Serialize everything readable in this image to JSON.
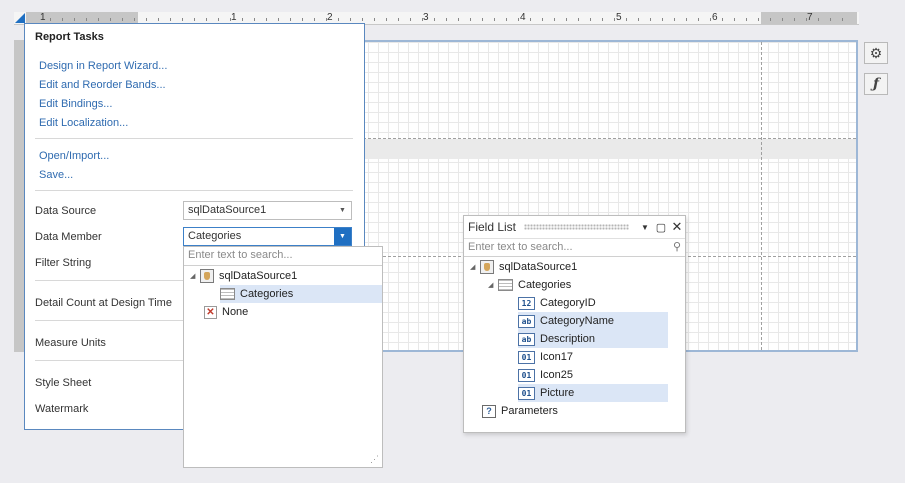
{
  "ruler": {
    "numbers": [
      "1",
      "1",
      "2",
      "3",
      "4",
      "5",
      "6",
      "7"
    ]
  },
  "side_buttons": {
    "settings": "⚙",
    "function": "ƒ"
  },
  "tasks": {
    "title": "Report Tasks",
    "links": [
      "Design in Report Wizard...",
      "Edit and Reorder Bands...",
      "Edit Bindings...",
      "Edit Localization..."
    ],
    "links2": [
      "Open/Import...",
      "Save..."
    ],
    "labels": {
      "data_source": "Data Source",
      "data_member": "Data Member",
      "filter_string": "Filter String",
      "detail_count": "Detail Count at Design Time",
      "measure_units": "Measure Units",
      "style_sheet": "Style Sheet",
      "watermark": "Watermark"
    },
    "data_source_value": "sqlDataSource1",
    "data_member_value": "Categories"
  },
  "dropdown": {
    "placeholder": "Enter text to search...",
    "items": [
      "sqlDataSource1",
      "Categories",
      "None"
    ]
  },
  "field_list": {
    "title": "Field List",
    "placeholder": "Enter text to search...",
    "root": "sqlDataSource1",
    "table": "Categories",
    "fields": [
      {
        "name": "CategoryID",
        "icon": "12"
      },
      {
        "name": "CategoryName",
        "icon": "ab"
      },
      {
        "name": "Description",
        "icon": "ab"
      },
      {
        "name": "Icon17",
        "icon": "01"
      },
      {
        "name": "Icon25",
        "icon": "01"
      },
      {
        "name": "Picture",
        "icon": "01"
      }
    ],
    "parameters": "Parameters",
    "parameters_icon": "?"
  },
  "colors": {
    "accent": "#1f6fc2",
    "link": "#2f6bb0",
    "selection": "#dbe6f6"
  }
}
